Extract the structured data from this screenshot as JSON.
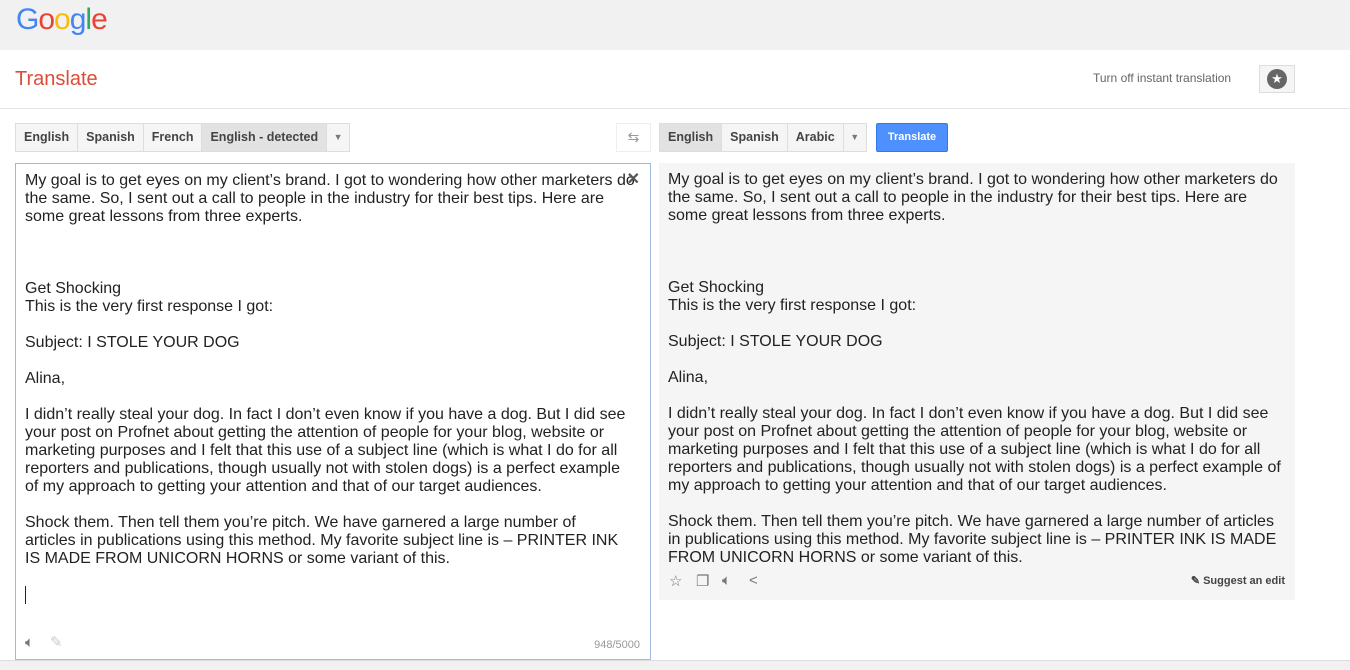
{
  "header": {
    "logo": "Google",
    "title": "Translate",
    "instant_toggle": "Turn off instant translation",
    "star_icon": "star-icon"
  },
  "source": {
    "languages": [
      "English",
      "Spanish",
      "French",
      "English - detected"
    ],
    "selected": "English - detected",
    "char_count": "948/5000",
    "lines": [
      "My goal is to get eyes on my client’s brand. I got to wondering how other marketers do",
      "the same. So, I sent out a call to people in the industry for their best tips. Here are",
      "some great lessons from three experts.",
      "",
      "",
      "",
      "Get Shocking",
      "This is the very first response I got:",
      "",
      "Subject: I STOLE YOUR DOG",
      "",
      "Alina,",
      "",
      "I didn’t really steal your dog. In fact I don’t even know if you have a dog. But I did see",
      "your post on Profnet about getting the attention of people for your blog, website or",
      "marketing purposes and I felt that this use of a subject line (which is what I do for all",
      "reporters and publications, though usually not with stolen dogs) is a perfect example",
      "of my approach to getting your attention and that of our target audiences.",
      "",
      "Shock them. Then tell them you’re pitch. We have garnered a large number of",
      "articles in publications using this method. My favorite subject line is – PRINTER INK",
      "IS MADE FROM UNICORN HORNS or some variant of this."
    ]
  },
  "target": {
    "languages": [
      "English",
      "Spanish",
      "Arabic"
    ],
    "selected": "English",
    "translate_label": "Translate",
    "suggest_label": "Suggest an edit",
    "lines": [
      "My goal is to get eyes on my client’s brand. I got to wondering how other marketers do",
      "the same. So, I sent out a call to people in the industry for their best tips. Here are",
      "some great lessons from three experts.",
      "",
      "",
      "",
      "Get Shocking",
      "This is the very first response I got:",
      "",
      "Subject: I STOLE YOUR DOG",
      "",
      "Alina,",
      "",
      "I didn’t really steal your dog. In fact I don’t even know if you have a dog. But I did see",
      "your post on Profnet about getting the attention of people for your blog, website or",
      "marketing purposes and I felt that this use of a subject line (which is what I do for all",
      "reporters and publications, though usually not with stolen dogs) is a perfect example of",
      "my approach to getting your attention and that of our target audiences.",
      "",
      "Shock them. Then tell them you’re pitch. We have garnered a large number of articles",
      "in publications using this method. My favorite subject line is – PRINTER INK IS MADE",
      "FROM UNICORN HORNS or some variant of this."
    ]
  },
  "colors": {
    "accent": "#4d90fe",
    "title": "#dd4b39"
  }
}
